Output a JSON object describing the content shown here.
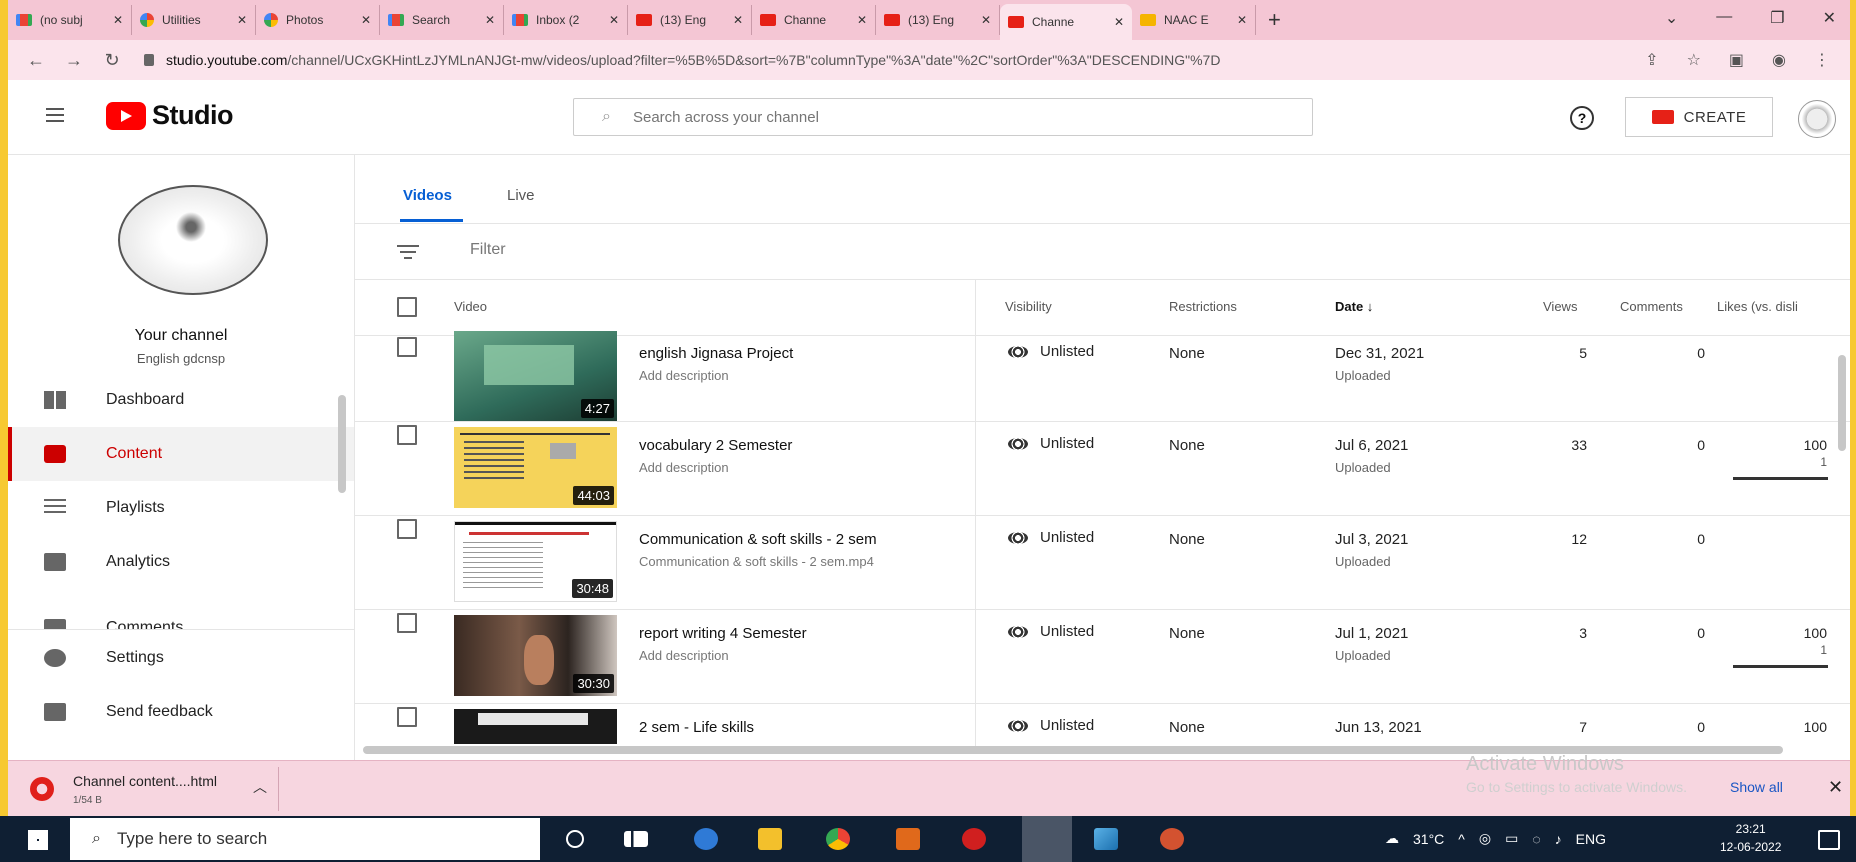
{
  "browser": {
    "tabs": [
      {
        "label": "(no subj",
        "icon": "gmail-icon"
      },
      {
        "label": "Utilities",
        "icon": "photos-icon"
      },
      {
        "label": "Photos",
        "icon": "photos-icon"
      },
      {
        "label": "Search",
        "icon": "gmail-icon"
      },
      {
        "label": "Inbox (2",
        "icon": "gmail-icon"
      },
      {
        "label": "(13) Eng",
        "icon": "youtube-icon"
      },
      {
        "label": "Channe",
        "icon": "youtube-icon"
      },
      {
        "label": "(13) Eng",
        "icon": "youtube-icon"
      },
      {
        "label": "Channe",
        "icon": "youtube-icon"
      },
      {
        "label": "NAAC E",
        "icon": "doc-icon"
      }
    ],
    "url_host": "studio.youtube.com",
    "url_path": "/channel/UCxGKHintLzJYMLnANJGt-mw/videos/upload?filter=%5B%5D&sort=%7B\"columnType\"%3A\"date\"%2C\"sortOrder\"%3A\"DESCENDING\"%7D"
  },
  "header": {
    "logo_text": "Studio",
    "search_placeholder": "Search across your channel",
    "create_label": "CREATE"
  },
  "sidebar": {
    "channel_title": "Your channel",
    "channel_name": "English gdcnsp",
    "items": [
      {
        "label": "Dashboard"
      },
      {
        "label": "Content"
      },
      {
        "label": "Playlists"
      },
      {
        "label": "Analytics"
      },
      {
        "label": "Comments"
      },
      {
        "label": "Settings"
      },
      {
        "label": "Send feedback"
      }
    ]
  },
  "content": {
    "tabs": [
      "Videos",
      "Live"
    ],
    "filter_label": "Filter",
    "columns": {
      "video": "Video",
      "visibility": "Visibility",
      "restrictions": "Restrictions",
      "date": "Date ↓",
      "views": "Views",
      "comments": "Comments",
      "likes": "Likes (vs. disli"
    },
    "rows": [
      {
        "title": "english Jignasa Project",
        "desc": "Add description",
        "duration": "4:27",
        "visibility": "Unlisted",
        "restrictions": "None",
        "date": "Dec 31, 2021",
        "status": "Uploaded",
        "views": "5",
        "comments": "0",
        "likes": "",
        "likes_sub": "",
        "like_bar": 0
      },
      {
        "title": "vocabulary 2 Semester",
        "desc": "Add description",
        "duration": "44:03",
        "visibility": "Unlisted",
        "restrictions": "None",
        "date": "Jul 6, 2021",
        "status": "Uploaded",
        "views": "33",
        "comments": "0",
        "likes": "100",
        "likes_sub": "1",
        "like_bar": 1
      },
      {
        "title": "Communication & soft skills - 2 sem",
        "desc": "Communication & soft skills - 2 sem.mp4",
        "duration": "30:48",
        "visibility": "Unlisted",
        "restrictions": "None",
        "date": "Jul 3, 2021",
        "status": "Uploaded",
        "views": "12",
        "comments": "0",
        "likes": "",
        "likes_sub": "",
        "like_bar": 0
      },
      {
        "title": "report writing 4 Semester",
        "desc": "Add description",
        "duration": "30:30",
        "visibility": "Unlisted",
        "restrictions": "None",
        "date": "Jul 1, 2021",
        "status": "Uploaded",
        "views": "3",
        "comments": "0",
        "likes": "100",
        "likes_sub": "1",
        "like_bar": 1
      },
      {
        "title": "2 sem - Life skills",
        "desc": "",
        "duration": "",
        "visibility": "Unlisted",
        "restrictions": "None",
        "date": "Jun 13, 2021",
        "status": "",
        "views": "7",
        "comments": "0",
        "likes": "100",
        "likes_sub": "",
        "like_bar": 0
      }
    ]
  },
  "download": {
    "file_name": "Channel content....html",
    "file_size": "1/54 B",
    "show_all": "Show all",
    "watermark_title": "Activate Windows",
    "watermark_sub": "Go to Settings to activate Windows."
  },
  "taskbar": {
    "search_placeholder": "Type here to search",
    "temperature": "31°C",
    "language": "ENG",
    "time": "23:21",
    "date": "12-06-2022"
  }
}
